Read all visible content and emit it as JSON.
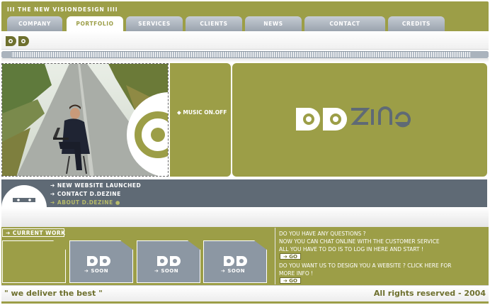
{
  "header": {
    "site_title": "III THE NEW VISIONDESIGN IIII"
  },
  "nav": {
    "tabs": [
      {
        "label": "COMPANY"
      },
      {
        "label": "PORTFOLIO"
      },
      {
        "label": "SERVICES"
      },
      {
        "label": "CLIENTS"
      },
      {
        "label": "NEWS"
      },
      {
        "label": "CONTACT"
      },
      {
        "label": "CREDITS"
      }
    ],
    "active_tab": "PORTFOLIO"
  },
  "hero": {
    "music_toggle": "MUSIC ON.OFF",
    "brand_logo": "DDzine logo"
  },
  "news": {
    "items": [
      {
        "label": "NEW WEBSITE LAUNCHED"
      },
      {
        "label": "CONTACT D.DEZINE"
      },
      {
        "label": "ABOUT D.DEZINE"
      }
    ]
  },
  "work": {
    "heading": "CURRENT WORK",
    "tiles": [
      {
        "label": "SOON"
      },
      {
        "label": "SOON"
      },
      {
        "label": "SOON"
      }
    ]
  },
  "info": {
    "chat_lines": [
      "DO  YOU HAVE ANY QUESTIONS ?",
      "NOW YOU CAN CHAT ONLINE WITH THE CUSTOMER SERVICE",
      "ALL YOU HAVE TO DO IS TO LOG IN HERE AND START !"
    ],
    "design_lines": [
      "DO YOU WANT US TO DESIGN YOU A WEBSITE ? CLICK HERE FOR",
      "MORE INFO !"
    ],
    "go_label": "GO"
  },
  "footer": {
    "slogan": "\" we deliver the best \"",
    "copyright": "All rights reserved - 2004"
  },
  "colors": {
    "olive": "#9c9e47",
    "slate": "#5f6a75",
    "tile_gray": "#8c97a3",
    "text_dark_olive": "#6e702e"
  }
}
